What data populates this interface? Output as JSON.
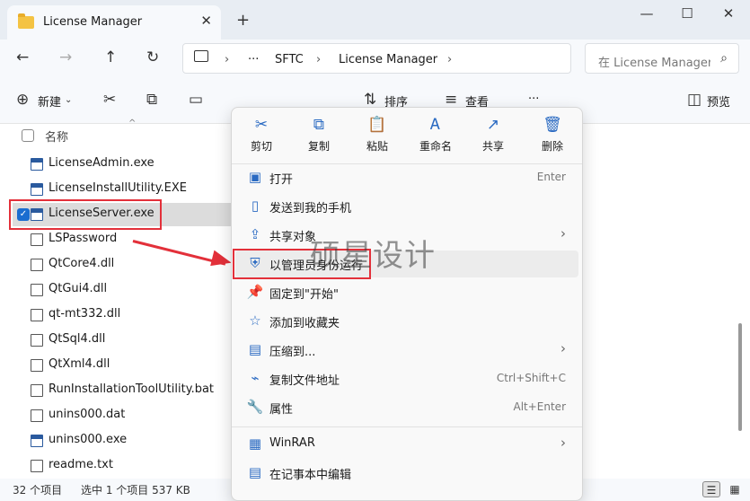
{
  "window": {
    "tab_title": "License Manager",
    "tab_close": "✕",
    "new_tab": "+",
    "minimize": "—",
    "maximize": "☐",
    "close": "✕"
  },
  "address": {
    "back": "←",
    "forward": "→",
    "up": "↑",
    "refresh": "↻",
    "computer_icon": "computer-icon",
    "more": "···",
    "crumbs": [
      "SFTC",
      "License Manager"
    ],
    "search_placeholder": "在 License Manager 中搜索"
  },
  "toolbar": {
    "new_label": "新建",
    "sort_label": "排序",
    "view_label": "查看",
    "more": "···",
    "preview_label": "预览"
  },
  "list": {
    "name_header": "名称",
    "files": [
      {
        "name": "LicenseAdmin.exe",
        "type": "exe"
      },
      {
        "name": "LicenseInstallUtility.EXE",
        "type": "exe"
      },
      {
        "name": "LicenseServer.exe",
        "type": "exe",
        "selected": true
      },
      {
        "name": "LSPassword",
        "type": "file"
      },
      {
        "name": "QtCore4.dll",
        "type": "dll"
      },
      {
        "name": "QtGui4.dll",
        "type": "dll"
      },
      {
        "name": "qt-mt332.dll",
        "type": "dll"
      },
      {
        "name": "QtSql4.dll",
        "type": "dll"
      },
      {
        "name": "QtXml4.dll",
        "type": "dll"
      },
      {
        "name": "RunInstallationToolUtility.bat",
        "type": "bat"
      },
      {
        "name": "unins000.dat",
        "type": "file"
      },
      {
        "name": "unins000.exe",
        "type": "exe"
      },
      {
        "name": "readme.txt",
        "type": "txt"
      }
    ]
  },
  "status": {
    "count": "32 个项目",
    "selection": "选中 1 个项目  537 KB"
  },
  "context_menu": {
    "quick_actions": [
      {
        "label": "剪切",
        "icon": "✂"
      },
      {
        "label": "复制",
        "icon": "⧉"
      },
      {
        "label": "粘贴",
        "icon": "📋"
      },
      {
        "label": "重命名",
        "icon": "Ꭺ"
      },
      {
        "label": "共享",
        "icon": "↗"
      },
      {
        "label": "删除",
        "icon": "🗑"
      }
    ],
    "items": [
      {
        "label": "打开",
        "shortcut": "Enter",
        "icon": "▣"
      },
      {
        "label": "发送到我的手机",
        "shortcut": "",
        "icon": "▯"
      },
      {
        "label": "共享对象",
        "shortcut": "",
        "icon": "⇪",
        "submenu": true
      },
      {
        "label": "以管理员身份运行",
        "shortcut": "",
        "icon": "⛨",
        "highlight": true
      },
      {
        "label": "固定到\"开始\"",
        "shortcut": "",
        "icon": "📌"
      },
      {
        "label": "添加到收藏夹",
        "shortcut": "",
        "icon": "☆"
      },
      {
        "label": "压缩到...",
        "shortcut": "",
        "icon": "▤",
        "submenu": true
      },
      {
        "label": "复制文件地址",
        "shortcut": "Ctrl+Shift+C",
        "icon": "⌁"
      },
      {
        "label": "属性",
        "shortcut": "Alt+Enter",
        "icon": "🔧"
      },
      {
        "label": "WinRAR",
        "shortcut": "",
        "icon": "▦",
        "submenu": true
      },
      {
        "label": "在记事本中编辑",
        "shortcut": "",
        "icon": "▤"
      }
    ]
  },
  "watermark": "硕星设计",
  "colors": {
    "accent": "#1a6dd0",
    "annotation": "#e3303a"
  }
}
